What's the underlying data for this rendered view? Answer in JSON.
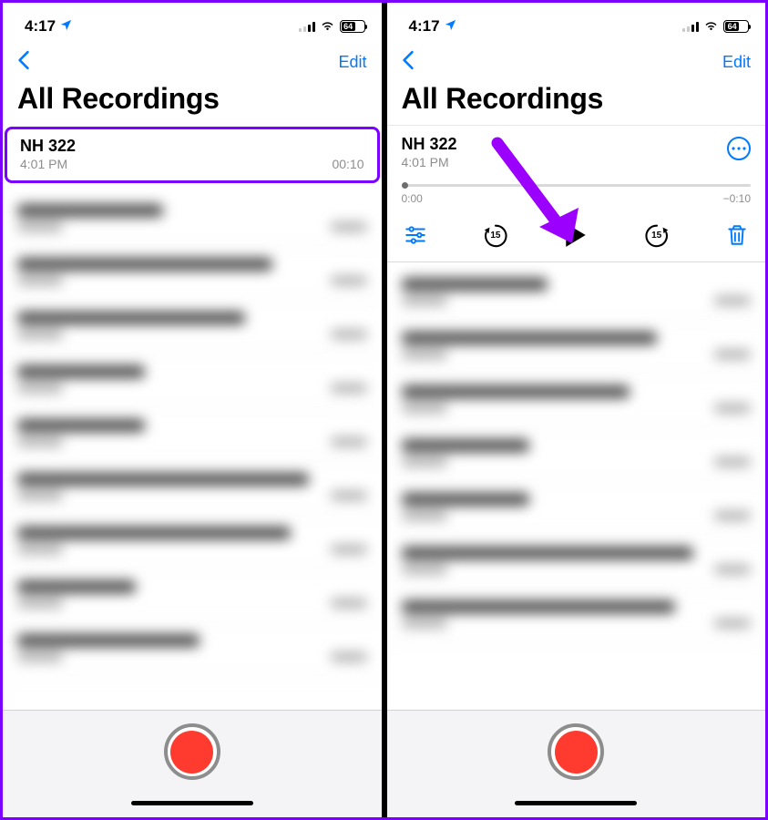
{
  "status": {
    "time": "4:17",
    "battery_pct": "64"
  },
  "nav": {
    "edit": "Edit"
  },
  "title": "All Recordings",
  "recording": {
    "name": "NH 322",
    "subtime": "4:01 PM",
    "duration": "00:10"
  },
  "player": {
    "name": "NH 322",
    "subtime": "4:01 PM",
    "elapsed": "0:00",
    "remaining": "−0:10",
    "skip_seconds": "15"
  },
  "colors": {
    "accent": "#007aff",
    "highlight": "#7b00ff",
    "record": "#ff3b30"
  }
}
